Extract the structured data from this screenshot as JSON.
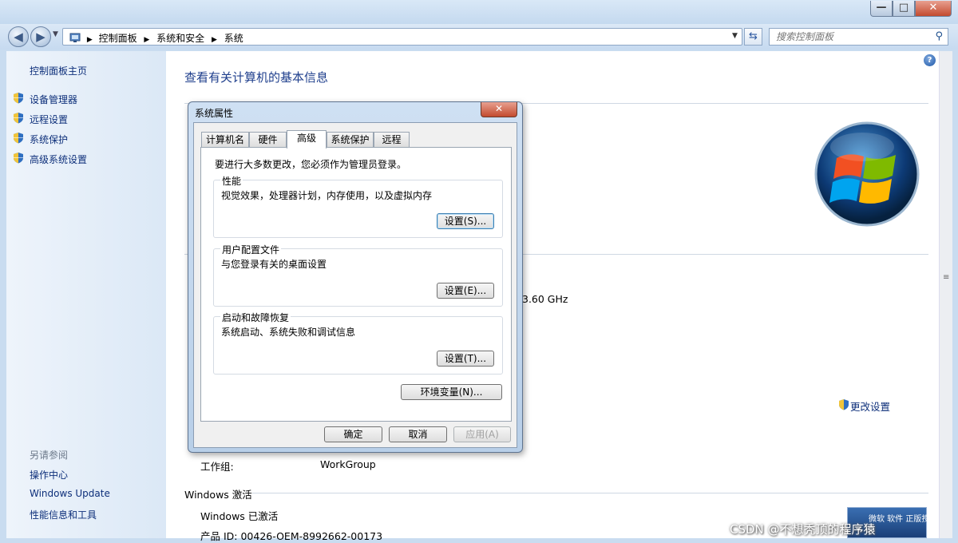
{
  "window": {
    "min_glyph": "—",
    "max_glyph": "□",
    "close_glyph": "✕"
  },
  "nav": {
    "back_glyph": "◀",
    "forward_glyph": "▶",
    "breadcrumb": [
      "控制面板",
      "系统和安全",
      "系统"
    ],
    "search_placeholder": "搜索控制面板"
  },
  "sidebar": {
    "home": "控制面板主页",
    "items": [
      {
        "label": "设备管理器",
        "icon": "shield-icon"
      },
      {
        "label": "远程设置",
        "icon": "shield-icon"
      },
      {
        "label": "系统保护",
        "icon": "shield-icon"
      },
      {
        "label": "高级系统设置",
        "icon": "shield-icon"
      }
    ],
    "see_also_title": "另请参阅",
    "see_also": [
      "操作中心",
      "Windows Update",
      "性能信息和工具"
    ]
  },
  "main": {
    "page_title": "查看有关计算机的基本信息",
    "cpu_speed_fragment": "3.60 GHz",
    "change_settings": "更改设置",
    "workgroup_label": "工作组:",
    "workgroup_value": "WorkGroup",
    "activation_title": "Windows 激活",
    "activation_status": "Windows 已激活",
    "product_id": "产品 ID: 00426-OEM-8992662-00173",
    "genuine_badge": "微软 软件 正版授权"
  },
  "dialog": {
    "title": "系统属性",
    "close_glyph": "✕",
    "tabs": [
      "计算机名",
      "硬件",
      "高级",
      "系统保护",
      "远程"
    ],
    "active_tab": "高级",
    "admin_note": "要进行大多数更改，您必须作为管理员登录。",
    "groups": [
      {
        "title": "性能",
        "desc": "视觉效果，处理器计划，内存使用，以及虚拟内存",
        "button": "设置(S)..."
      },
      {
        "title": "用户配置文件",
        "desc": "与您登录有关的桌面设置",
        "button": "设置(E)..."
      },
      {
        "title": "启动和故障恢复",
        "desc": "系统启动、系统失败和调试信息",
        "button": "设置(T)..."
      }
    ],
    "env_button": "环境变量(N)...",
    "ok": "确定",
    "cancel": "取消",
    "apply": "应用(A)"
  },
  "watermark": "CSDN @不想秃顶的程序猿",
  "colors": {
    "link": "#0d2f7a",
    "title_blue": "#1e3e8c",
    "accent": "#3c7fb1"
  }
}
